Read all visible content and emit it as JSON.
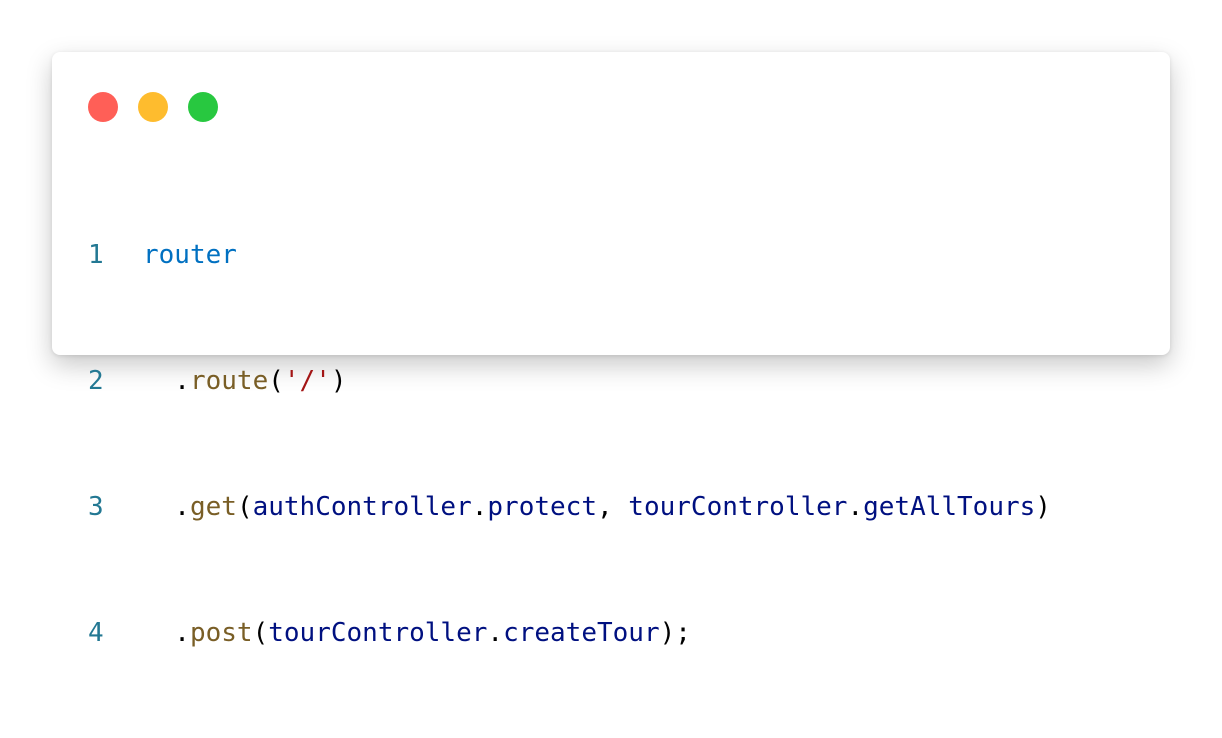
{
  "window": {
    "controls": [
      {
        "name": "close",
        "color": "#ff5f57"
      },
      {
        "name": "minimize",
        "color": "#febc2e"
      },
      {
        "name": "maximize",
        "color": "#28c840"
      }
    ]
  },
  "code": {
    "lines": [
      {
        "number": "1",
        "tokens": [
          {
            "text": "router",
            "kind": "ident"
          }
        ]
      },
      {
        "number": "2",
        "tokens": [
          {
            "text": "  .",
            "kind": "punct"
          },
          {
            "text": "route",
            "kind": "method"
          },
          {
            "text": "(",
            "kind": "punct"
          },
          {
            "text": "'/'",
            "kind": "string"
          },
          {
            "text": ")",
            "kind": "punct"
          }
        ]
      },
      {
        "number": "3",
        "tokens": [
          {
            "text": "  .",
            "kind": "punct"
          },
          {
            "text": "get",
            "kind": "method"
          },
          {
            "text": "(",
            "kind": "punct"
          },
          {
            "text": "authController",
            "kind": "prop"
          },
          {
            "text": ".",
            "kind": "punct"
          },
          {
            "text": "protect",
            "kind": "prop"
          },
          {
            "text": ", ",
            "kind": "punct"
          },
          {
            "text": "tourController",
            "kind": "prop"
          },
          {
            "text": ".",
            "kind": "punct"
          },
          {
            "text": "getAllTours",
            "kind": "prop"
          },
          {
            "text": ")",
            "kind": "punct"
          }
        ]
      },
      {
        "number": "4",
        "tokens": [
          {
            "text": "  .",
            "kind": "punct"
          },
          {
            "text": "post",
            "kind": "method"
          },
          {
            "text": "(",
            "kind": "punct"
          },
          {
            "text": "tourController",
            "kind": "prop"
          },
          {
            "text": ".",
            "kind": "punct"
          },
          {
            "text": "createTour",
            "kind": "prop"
          },
          {
            "text": ");",
            "kind": "punct"
          }
        ]
      }
    ]
  }
}
